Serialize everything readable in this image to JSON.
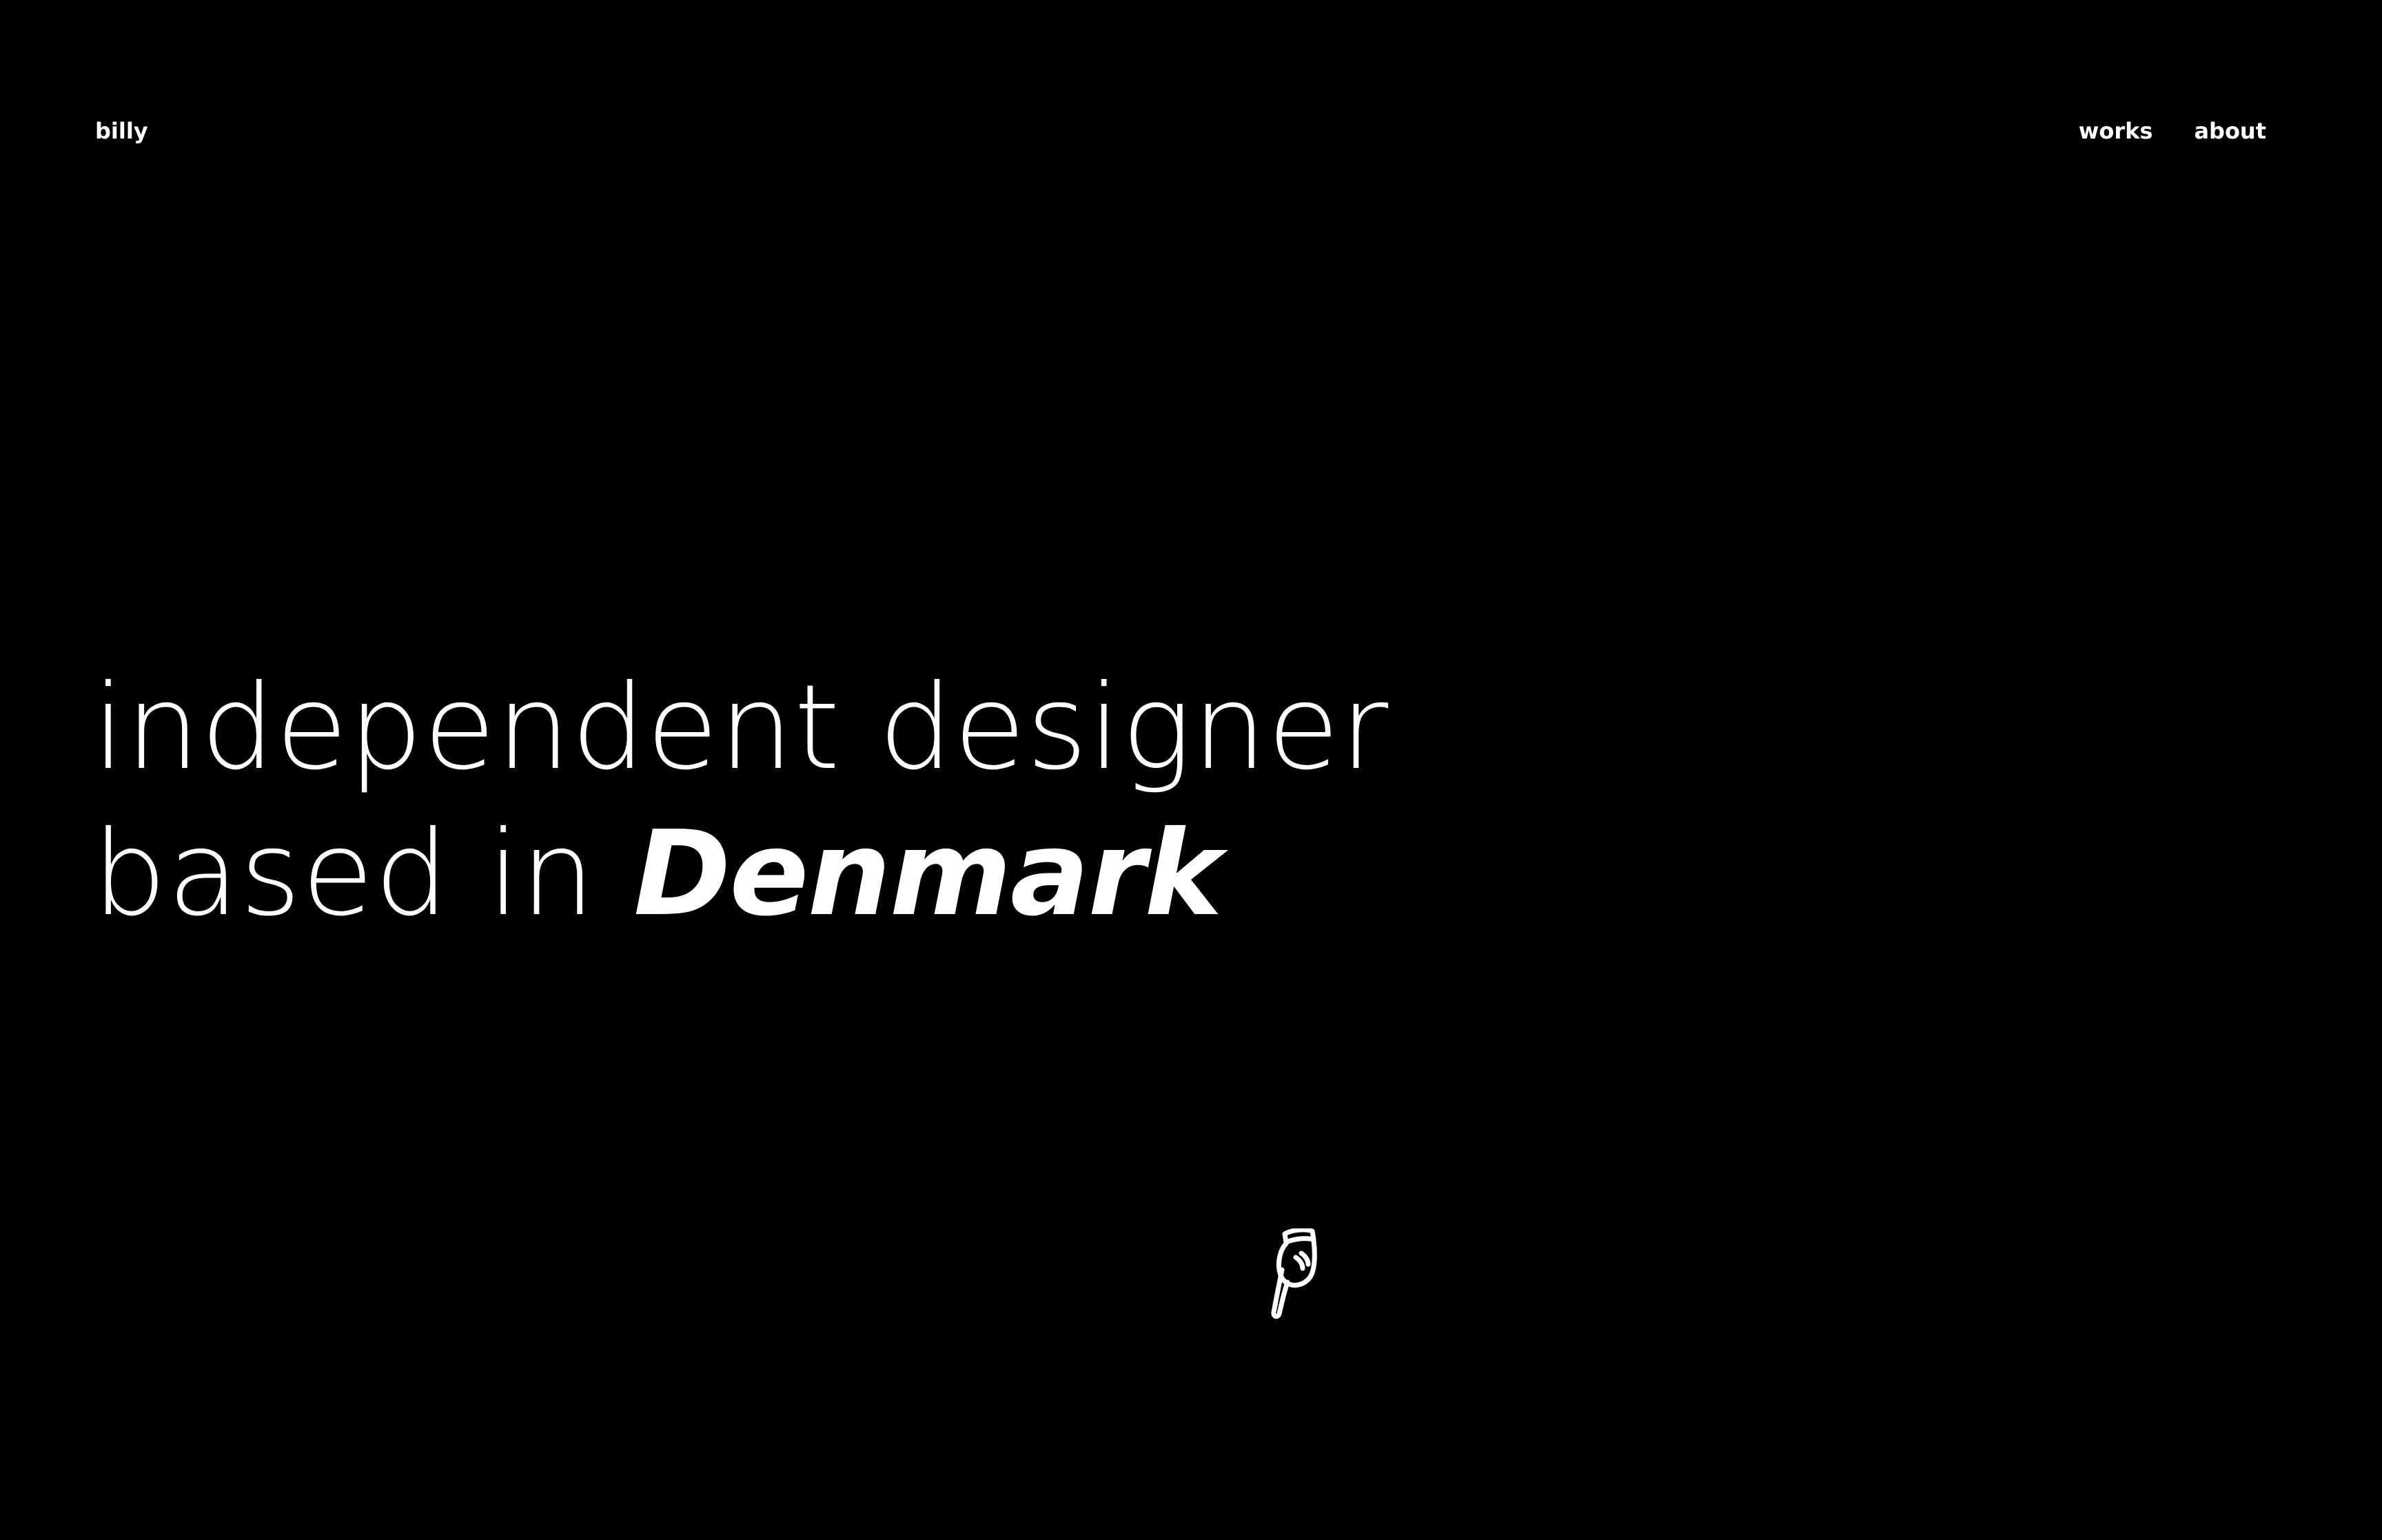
{
  "header": {
    "logo": "billy",
    "nav": [
      {
        "label": "works"
      },
      {
        "label": "about"
      }
    ]
  },
  "hero": {
    "line1": "independent designer",
    "line2_prefix": "based in",
    "line2_emphasis": "Denmark"
  },
  "scroll_hint": {
    "icon": "pointing-down-hand-icon"
  },
  "colors": {
    "background": "#000000",
    "text": "#ffffff"
  }
}
